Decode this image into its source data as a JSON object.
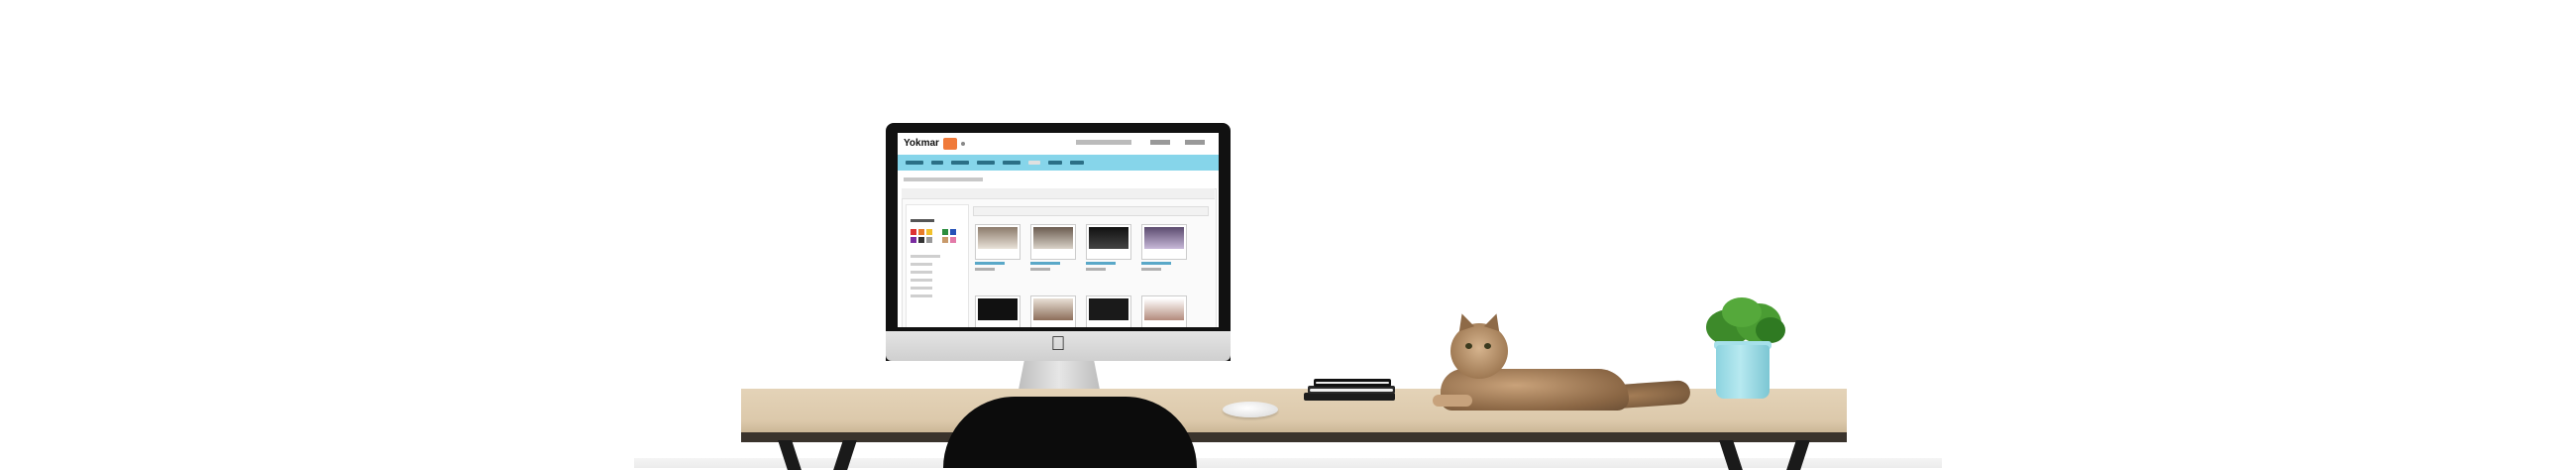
{
  "scene": {
    "description_label": "",
    "colors": {
      "background": "#ffffff",
      "desk_wood": "#dcc9ab",
      "screen_nav": "#86d5ea",
      "brand_orange": "#f07a3a",
      "plant_pot": "#8cd3df",
      "chair": "#0c0c0c"
    }
  },
  "screen": {
    "logo_text": "Yokmar",
    "icons": [
      "apple-logo-icon"
    ]
  }
}
